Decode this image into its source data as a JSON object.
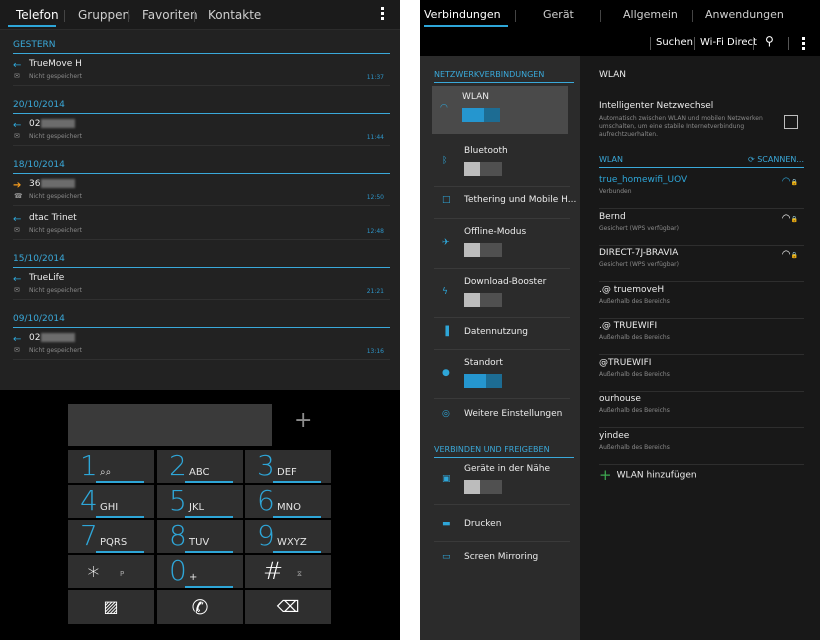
{
  "phone": {
    "tabs": [
      "Telefon",
      "Gruppen",
      "Favoriten",
      "Kontakte"
    ],
    "log": [
      {
        "header": "GESTERN",
        "entries": [
          {
            "name": "TrueMove H",
            "sub": "Nicht gespeichert",
            "time": "11:37",
            "dir": "in",
            "blur": false
          }
        ]
      },
      {
        "header": "20/10/2014",
        "entries": [
          {
            "name": "02",
            "sub": "Nicht gespeichert",
            "time": "11:44",
            "dir": "in",
            "blur": true
          }
        ]
      },
      {
        "header": "18/10/2014",
        "entries": [
          {
            "name": "36",
            "sub": "Nicht gespeichert",
            "time": "12:50",
            "dir": "out",
            "blur": true
          },
          {
            "name": "dtac Trinet",
            "sub": "Nicht gespeichert",
            "time": "12:48",
            "dir": "in",
            "blur": false
          }
        ]
      },
      {
        "header": "15/10/2014",
        "entries": [
          {
            "name": "TrueLife",
            "sub": "Nicht gespeichert",
            "time": "21:21",
            "dir": "in",
            "blur": false
          }
        ]
      },
      {
        "header": "09/10/2014",
        "entries": [
          {
            "name": "02",
            "sub": "Nicht gespeichert",
            "time": "13:16",
            "dir": "in",
            "blur": true
          }
        ]
      }
    ],
    "plus": "+",
    "keys": [
      {
        "d": "1",
        "l": "⌕⌕"
      },
      {
        "d": "2",
        "l": "ABC"
      },
      {
        "d": "3",
        "l": "DEF"
      },
      {
        "d": "4",
        "l": "GHI"
      },
      {
        "d": "5",
        "l": "JKL"
      },
      {
        "d": "6",
        "l": "MNO"
      },
      {
        "d": "7",
        "l": "PQRS"
      },
      {
        "d": "8",
        "l": "TUV"
      },
      {
        "d": "9",
        "l": "WXYZ"
      },
      {
        "d": "∗",
        "l": "P"
      },
      {
        "d": "0",
        "l": "+"
      },
      {
        "d": "#",
        "l": "⧖"
      }
    ]
  },
  "tablet": {
    "tabs": [
      "Verbindungen",
      "Gerät",
      "Allgemein",
      "Anwendungen"
    ],
    "actions": {
      "search": "Suchen",
      "wifi_direct": "Wi-Fi Direct"
    },
    "menu": {
      "sec1": "NETZWERKVERBINDUNGEN",
      "sec2": "VERBINDEN UND FREIGEBEN",
      "items": [
        {
          "label": "WLAN",
          "icon": "wifi-icon",
          "toggle": "on"
        },
        {
          "label": "Bluetooth",
          "icon": "bluetooth-icon",
          "toggle": "off"
        },
        {
          "label": "Tethering und Mobile H...",
          "icon": "tethering-icon",
          "toggle": null
        },
        {
          "label": "Offline-Modus",
          "icon": "airplane-icon",
          "toggle": "off"
        },
        {
          "label": "Download-Booster",
          "icon": "booster-icon",
          "toggle": "off"
        },
        {
          "label": "Datennutzung",
          "icon": "data-usage-icon",
          "toggle": null
        },
        {
          "label": "Standort",
          "icon": "location-icon",
          "toggle": "on"
        },
        {
          "label": "Weitere Einstellungen",
          "icon": "more-settings-icon",
          "toggle": null
        },
        {
          "label": "Geräte in der Nähe",
          "icon": "nearby-devices-icon",
          "toggle": "off"
        },
        {
          "label": "Drucken",
          "icon": "print-icon",
          "toggle": null
        },
        {
          "label": "Screen Mirroring",
          "icon": "screen-mirroring-icon",
          "toggle": null
        }
      ]
    },
    "detail": {
      "title": "WLAN",
      "smart_title": "Intelligenter Netzwechsel",
      "smart_sub": "Automatisch zwischen WLAN und mobilen Netzwerken umschalten, um eine stabile Internetverbindung aufrechtzuerhalten.",
      "sec": "WLAN",
      "scan": "SCANNEN...",
      "networks": [
        {
          "ssid": "true_homewifi_UOV",
          "status": "Verbunden",
          "signal": true,
          "connected": true
        },
        {
          "ssid": "Bernd",
          "status": "Gesichert (WPS verfügbar)",
          "signal": true,
          "connected": false
        },
        {
          "ssid": "DIRECT-7J-BRAVIA",
          "status": "Gesichert (WPS verfügbar)",
          "signal": true,
          "connected": false
        },
        {
          "ssid": ".@ truemoveH",
          "status": "Außerhalb des Bereichs",
          "signal": false,
          "connected": false
        },
        {
          "ssid": ".@ TRUEWIFI",
          "status": "Außerhalb des Bereichs",
          "signal": false,
          "connected": false
        },
        {
          "ssid": "@TRUEWIFI",
          "status": "Außerhalb des Bereichs",
          "signal": false,
          "connected": false
        },
        {
          "ssid": "ourhouse",
          "status": "Außerhalb des Bereichs",
          "signal": false,
          "connected": false
        },
        {
          "ssid": "yindee",
          "status": "Außerhalb des Bereichs",
          "signal": false,
          "connected": false
        }
      ],
      "add": "WLAN hinzufügen"
    }
  }
}
